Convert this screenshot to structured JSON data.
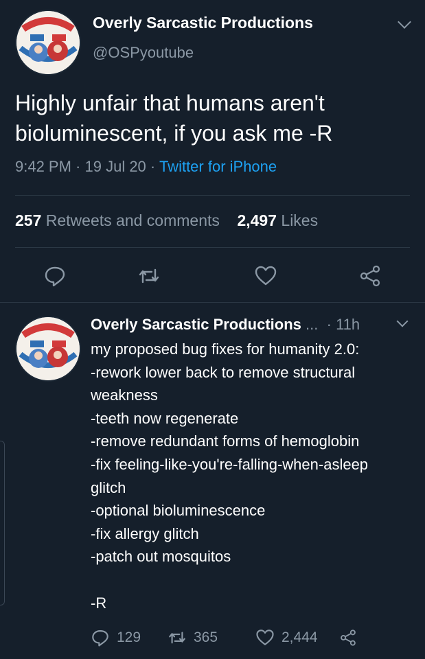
{
  "colors": {
    "background": "#151f2b",
    "text_primary": "#ffffff",
    "text_secondary": "#8b98a5",
    "link": "#1da1f2",
    "divider": "#2b3845"
  },
  "main_tweet": {
    "author_name": "Overly Sarcastic Productions",
    "handle": "@OSPyoutube",
    "text": "Highly unfair that humans aren't bioluminescent, if you ask me -R",
    "time": "9:42 PM",
    "date": "19 Jul 20",
    "source": "Twitter for iPhone",
    "separator": " · ",
    "retweets_count": "257",
    "retweets_label": "Retweets and comments",
    "likes_count": "2,497",
    "likes_label": "Likes",
    "icons": {
      "avatar": "channel-logo",
      "menu": "chevron-down-icon",
      "reply": "reply-icon",
      "retweet": "retweet-icon",
      "like": "heart-icon",
      "share": "share-icon"
    }
  },
  "reply_tweet": {
    "author_name": "Overly Sarcastic Productions",
    "ellipsis": "...",
    "time_separator": "·",
    "time": "11h",
    "lines": [
      "my proposed bug fixes for humanity 2.0:",
      "-rework lower back to remove structural",
      "weakness",
      "-teeth now regenerate",
      "-remove redundant forms of hemoglobin",
      "-fix feeling-like-you're-falling-when-asleep",
      "glitch",
      "-optional bioluminescence",
      "-fix allergy glitch",
      "-patch out mosquitos",
      "",
      "-R"
    ],
    "reply_count": "129",
    "retweet_count": "365",
    "like_count": "2,444"
  }
}
